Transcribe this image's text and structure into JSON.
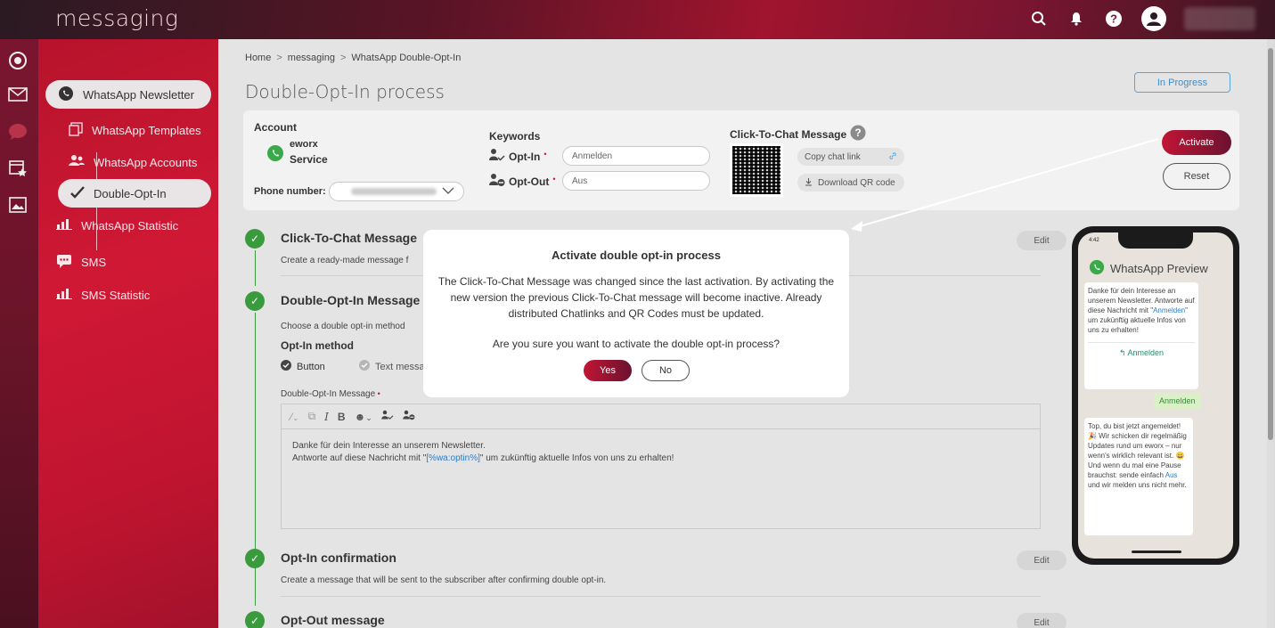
{
  "app": {
    "title": "messaging"
  },
  "header_icons": [
    "search-icon",
    "bell-icon",
    "help-icon",
    "user-avatar-icon"
  ],
  "sidebar": {
    "items": [
      {
        "label": "WhatsApp Newsletter",
        "icon": "whatsapp-icon",
        "active": true
      },
      {
        "label": "WhatsApp Templates",
        "icon": "template-icon"
      },
      {
        "label": "WhatsApp Accounts",
        "icon": "accounts-icon"
      },
      {
        "label": "Double-Opt-In",
        "icon": "checkmark-icon",
        "active": true
      },
      {
        "label": "WhatsApp Statistic",
        "icon": "bar-chart-icon"
      },
      {
        "label": "SMS",
        "icon": "sms-icon"
      },
      {
        "label": "SMS Statistic",
        "icon": "bar-chart-icon"
      }
    ]
  },
  "breadcrumb": [
    "Home",
    "messaging",
    "WhatsApp Double-Opt-In"
  ],
  "breadcrumb_sep": ">",
  "page": {
    "title": "Double-Opt-In process",
    "status": "In Progress"
  },
  "account": {
    "label": "Account",
    "name_line1": "eworx",
    "name_line2": "Service",
    "phone_label": "Phone number:",
    "keywords_label": "Keywords",
    "optin_label": "Opt-In",
    "optin_value": "Anmelden",
    "optout_label": "Opt-Out",
    "optout_value": "Aus",
    "click_to_chat_label": "Click-To-Chat Message",
    "copy_link": "Copy chat link",
    "download_qr": "Download QR code",
    "activate": "Activate",
    "reset": "Reset"
  },
  "steps": [
    {
      "title": "Click-To-Chat Message",
      "desc": "Create a ready-made message f",
      "edit": "Edit"
    },
    {
      "title": "Double-Opt-In Message",
      "desc": "Choose a double opt-in method",
      "edit": ""
    },
    {
      "title": "Opt-In confirmation",
      "desc": "Create a message that will be sent to the subscriber after confirming double opt-in.",
      "edit": "Edit"
    },
    {
      "title": "Opt-Out message",
      "desc": "",
      "edit": "Edit"
    }
  ],
  "optin_method": {
    "label": "Opt-In method",
    "option_button": "Button",
    "option_text": "Text messa",
    "message_label": "Double-Opt-In Message",
    "editor_line1": "Danke für dein Interesse an unserem Newsletter.",
    "editor_line2_pre": "Antworte auf diese Nachricht mit \"",
    "editor_token": "[%wa:optin%]",
    "editor_line2_post": "\" um zukünftig aktuelle Infos von uns zu erhalten!"
  },
  "preview": {
    "time": "4:42",
    "title": "WhatsApp Preview",
    "bubble1_a": "Danke für dein Interesse an unserem Newsletter. Antworte auf diese Nachricht mit \"",
    "bubble1_link": "Anmelden",
    "bubble1_b": "\" um zukünftig aktuelle Infos von uns zu erhalten!",
    "bubble1_button": "Anmelden",
    "out_message": "Anmelden",
    "bubble2_a": "Top, du bist jetzt angemeldet! 🎉 Wir schicken dir regelmäßig Updates rund um eworx – nur wenn's wirklich relevant ist. 😀 Und wenn du mal eine Pause brauchst: sende einfach ",
    "bubble2_link": "Aus",
    "bubble2_b": " und wir melden uns nicht mehr."
  },
  "modal": {
    "title": "Activate double opt-in process",
    "text": "The Click-To-Chat Message was changed since the last activation. By activating the new version the previous Click-To-Chat message will become inactive. Already distributed Chatlinks and QR Codes must be updated.",
    "question": "Are you sure you want to activate the double opt-in process?",
    "yes": "Yes",
    "no": "No"
  },
  "colors": {
    "brand": "#c21535",
    "success": "#3a9b3e",
    "link": "#2b7cc9"
  }
}
